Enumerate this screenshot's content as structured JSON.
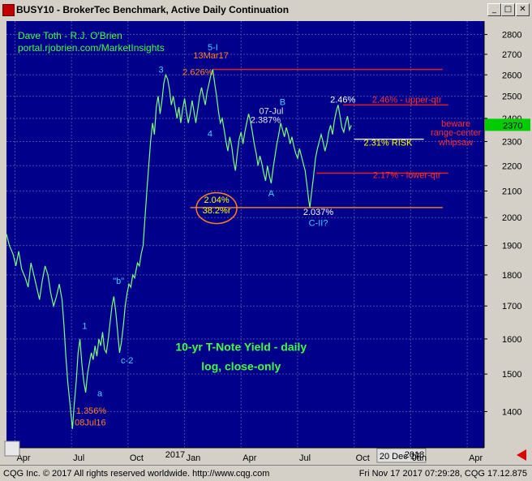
{
  "window": {
    "title": "BUSY10 - BrokerTec Benchmark, Active Daily Continuation",
    "min_label": "_",
    "max_label": "□",
    "close_label": "✕"
  },
  "status": {
    "left": "CQG Inc. © 2017 All rights reserved worldwide. http://www.cqg.com",
    "right": "Fri Nov 17 2017 07:29:28, CQG 17.12.875"
  },
  "chart_data": {
    "type": "line",
    "title": "10-yr T-Note Yield -  daily",
    "subtitle": "log, close-only",
    "credit_line1": "Dave Toth - R.J. O'Brien",
    "credit_line2": "portal.rjobrien.com/MarketInsights",
    "scale": "log",
    "ylim": [
      1310,
      2870
    ],
    "y_ticks": [
      1400,
      1500,
      1600,
      1700,
      1800,
      1900,
      2000,
      2100,
      2200,
      2300,
      2400,
      2500,
      2600,
      2700,
      2800
    ],
    "x_ticks": [
      {
        "label": "Apr",
        "pos": 0
      },
      {
        "label": "Jul",
        "pos": 3
      },
      {
        "label": "Oct",
        "pos": 6
      },
      {
        "label": "2017",
        "pos": 8.5
      },
      {
        "label": "Jan",
        "pos": 9
      },
      {
        "label": "Apr",
        "pos": 12
      },
      {
        "label": "Jul",
        "pos": 15
      },
      {
        "label": "Oct",
        "pos": 18
      },
      {
        "label": "20 Dec 17",
        "pos": 19.3
      },
      {
        "label": "2018",
        "pos": 21.2
      },
      {
        "label": "Jan",
        "pos": 21
      },
      {
        "label": "Apr",
        "pos": 24
      }
    ],
    "last_value_label": "2370",
    "series": [
      {
        "values": [
          [
            -0.45,
            1940
          ],
          [
            -0.3,
            1900
          ],
          [
            -0.1,
            1870
          ],
          [
            0.05,
            1830
          ],
          [
            0.2,
            1880
          ],
          [
            0.35,
            1820
          ],
          [
            0.55,
            1790
          ],
          [
            0.7,
            1760
          ],
          [
            0.85,
            1840
          ],
          [
            1.0,
            1800
          ],
          [
            1.15,
            1760
          ],
          [
            1.3,
            1720
          ],
          [
            1.45,
            1780
          ],
          [
            1.6,
            1830
          ],
          [
            1.75,
            1800
          ],
          [
            1.9,
            1740
          ],
          [
            2.05,
            1700
          ],
          [
            2.2,
            1730
          ],
          [
            2.35,
            1770
          ],
          [
            2.5,
            1720
          ],
          [
            2.6,
            1640
          ],
          [
            2.7,
            1550
          ],
          [
            2.8,
            1480
          ],
          [
            2.9,
            1430
          ],
          [
            3.0,
            1380
          ],
          [
            3.05,
            1356
          ],
          [
            3.15,
            1420
          ],
          [
            3.25,
            1480
          ],
          [
            3.35,
            1560
          ],
          [
            3.45,
            1600
          ],
          [
            3.55,
            1530
          ],
          [
            3.65,
            1480
          ],
          [
            3.75,
            1450
          ],
          [
            3.85,
            1500
          ],
          [
            3.95,
            1530
          ],
          [
            4.05,
            1560
          ],
          [
            4.15,
            1540
          ],
          [
            4.25,
            1580
          ],
          [
            4.35,
            1550
          ],
          [
            4.45,
            1600
          ],
          [
            4.55,
            1580
          ],
          [
            4.65,
            1620
          ],
          [
            4.75,
            1570
          ],
          [
            4.85,
            1560
          ],
          [
            4.95,
            1600
          ],
          [
            5.05,
            1650
          ],
          [
            5.15,
            1700
          ],
          [
            5.25,
            1730
          ],
          [
            5.35,
            1680
          ],
          [
            5.45,
            1620
          ],
          [
            5.55,
            1560
          ],
          [
            5.65,
            1590
          ],
          [
            5.75,
            1640
          ],
          [
            5.85,
            1700
          ],
          [
            5.95,
            1740
          ],
          [
            6.05,
            1770
          ],
          [
            6.15,
            1760
          ],
          [
            6.25,
            1800
          ],
          [
            6.35,
            1790
          ],
          [
            6.5,
            1840
          ],
          [
            6.6,
            1830
          ],
          [
            6.7,
            1870
          ],
          [
            6.8,
            1900
          ],
          [
            6.9,
            2000
          ],
          [
            7.0,
            2100
          ],
          [
            7.1,
            2200
          ],
          [
            7.2,
            2300
          ],
          [
            7.3,
            2380
          ],
          [
            7.4,
            2330
          ],
          [
            7.5,
            2450
          ],
          [
            7.6,
            2500
          ],
          [
            7.7,
            2420
          ],
          [
            7.8,
            2480
          ],
          [
            7.9,
            2560
          ],
          [
            8.0,
            2600
          ],
          [
            8.1,
            2580
          ],
          [
            8.2,
            2530
          ],
          [
            8.3,
            2460
          ],
          [
            8.4,
            2500
          ],
          [
            8.5,
            2450
          ],
          [
            8.6,
            2400
          ],
          [
            8.7,
            2450
          ],
          [
            8.8,
            2380
          ],
          [
            8.9,
            2440
          ],
          [
            9.0,
            2490
          ],
          [
            9.1,
            2430
          ],
          [
            9.2,
            2380
          ],
          [
            9.3,
            2420
          ],
          [
            9.4,
            2480
          ],
          [
            9.5,
            2430
          ],
          [
            9.6,
            2380
          ],
          [
            9.7,
            2440
          ],
          [
            9.8,
            2500
          ],
          [
            9.9,
            2540
          ],
          [
            10.0,
            2500
          ],
          [
            10.1,
            2460
          ],
          [
            10.2,
            2520
          ],
          [
            10.3,
            2560
          ],
          [
            10.4,
            2600
          ],
          [
            10.5,
            2626
          ],
          [
            10.6,
            2560
          ],
          [
            10.7,
            2500
          ],
          [
            10.8,
            2430
          ],
          [
            10.9,
            2380
          ],
          [
            11.0,
            2400
          ],
          [
            11.1,
            2350
          ],
          [
            11.2,
            2300
          ],
          [
            11.3,
            2260
          ],
          [
            11.4,
            2320
          ],
          [
            11.5,
            2280
          ],
          [
            11.6,
            2220
          ],
          [
            11.7,
            2180
          ],
          [
            11.8,
            2250
          ],
          [
            11.9,
            2310
          ],
          [
            12.0,
            2340
          ],
          [
            12.1,
            2290
          ],
          [
            12.2,
            2340
          ],
          [
            12.3,
            2380
          ],
          [
            12.4,
            2420
          ],
          [
            12.5,
            2387
          ],
          [
            12.6,
            2340
          ],
          [
            12.7,
            2290
          ],
          [
            12.8,
            2250
          ],
          [
            12.9,
            2200
          ],
          [
            13.0,
            2240
          ],
          [
            13.1,
            2210
          ],
          [
            13.2,
            2170
          ],
          [
            13.3,
            2140
          ],
          [
            13.4,
            2200
          ],
          [
            13.5,
            2160
          ],
          [
            13.6,
            2130
          ],
          [
            13.7,
            2190
          ],
          [
            13.8,
            2240
          ],
          [
            13.9,
            2290
          ],
          [
            14.0,
            2330
          ],
          [
            14.1,
            2380
          ],
          [
            14.2,
            2350
          ],
          [
            14.3,
            2320
          ],
          [
            14.4,
            2360
          ],
          [
            14.5,
            2330
          ],
          [
            14.6,
            2290
          ],
          [
            14.7,
            2320
          ],
          [
            14.8,
            2280
          ],
          [
            14.9,
            2250
          ],
          [
            15.0,
            2230
          ],
          [
            15.1,
            2270
          ],
          [
            15.2,
            2240
          ],
          [
            15.3,
            2210
          ],
          [
            15.4,
            2180
          ],
          [
            15.5,
            2120
          ],
          [
            15.6,
            2060
          ],
          [
            15.65,
            2037
          ],
          [
            15.75,
            2100
          ],
          [
            15.85,
            2160
          ],
          [
            15.95,
            2230
          ],
          [
            16.05,
            2270
          ],
          [
            16.15,
            2300
          ],
          [
            16.25,
            2330
          ],
          [
            16.35,
            2300
          ],
          [
            16.45,
            2260
          ],
          [
            16.55,
            2290
          ],
          [
            16.65,
            2340
          ],
          [
            16.75,
            2370
          ],
          [
            16.85,
            2330
          ],
          [
            16.95,
            2390
          ],
          [
            17.05,
            2430
          ],
          [
            17.15,
            2460
          ],
          [
            17.25,
            2410
          ],
          [
            17.35,
            2360
          ],
          [
            17.45,
            2340
          ],
          [
            17.55,
            2380
          ],
          [
            17.65,
            2410
          ],
          [
            17.75,
            2350
          ],
          [
            17.85,
            2370
          ]
        ]
      }
    ],
    "annotations": [
      {
        "text": "5-I",
        "x": 10.5,
        "y": 2720,
        "color": "#40d0ff"
      },
      {
        "text": "13Mar17",
        "x": 10.4,
        "y": 2680,
        "color": "#ff8020"
      },
      {
        "text": "2.626%",
        "x": 9.7,
        "y": 2600,
        "color": "#ff8020"
      },
      {
        "text": "3",
        "x": 7.75,
        "y": 2610,
        "color": "#40d0ff"
      },
      {
        "text": "4",
        "x": 10.35,
        "y": 2320,
        "color": "#40d0ff"
      },
      {
        "text": "B",
        "x": 14.2,
        "y": 2460,
        "color": "#40d0ff"
      },
      {
        "text": "07-Jul",
        "x": 13.6,
        "y": 2420,
        "color": "#e0e0e0"
      },
      {
        "text": "2.387%",
        "x": 13.3,
        "y": 2380,
        "color": "#e0e0e0"
      },
      {
        "text": "2.46%",
        "x": 17.4,
        "y": 2470,
        "color": "#ffffff"
      },
      {
        "text": "2.46% - upper-qtr",
        "x": 20.8,
        "y": 2470,
        "color": "#ff3030"
      },
      {
        "text": "2.31% RISK",
        "x": 19.8,
        "y": 2283,
        "color": "#ffff00"
      },
      {
        "text": "beware",
        "x": 23.4,
        "y": 2365,
        "color": "#ff3030"
      },
      {
        "text": "range-center",
        "x": 23.4,
        "y": 2325,
        "color": "#ff3030"
      },
      {
        "text": "whipsaw",
        "x": 23.4,
        "y": 2285,
        "color": "#ff3030"
      },
      {
        "text": "2.17% - lower-qtr",
        "x": 20.8,
        "y": 2150,
        "color": "#ff3030"
      },
      {
        "text": "A",
        "x": 13.6,
        "y": 2080,
        "color": "#40d0ff"
      },
      {
        "text": "2.04%",
        "x": 10.7,
        "y": 2055,
        "color": "#ffff00"
      },
      {
        "text": "38.2%r",
        "x": 10.7,
        "y": 2015,
        "color": "#ffff00"
      },
      {
        "text": "2.037%",
        "x": 16.1,
        "y": 2010,
        "color": "#ffffff"
      },
      {
        "text": "C-II?",
        "x": 16.1,
        "y": 1970,
        "color": "#40d0ff"
      },
      {
        "text": "\"b\"",
        "x": 5.5,
        "y": 1770,
        "color": "#40d0ff"
      },
      {
        "text": "1",
        "x": 3.7,
        "y": 1630,
        "color": "#40d0ff"
      },
      {
        "text": "c-2",
        "x": 5.95,
        "y": 1530,
        "color": "#40d0ff"
      },
      {
        "text": "a",
        "x": 4.5,
        "y": 1440,
        "color": "#40d0ff"
      },
      {
        "text": "1.356%",
        "x": 4.05,
        "y": 1395,
        "color": "#ff8020"
      },
      {
        "text": "08Jul16",
        "x": 4.0,
        "y": 1365,
        "color": "#ff8020"
      }
    ],
    "levels": [
      {
        "value": 2626,
        "from": 10.5,
        "to": 22.7,
        "color": "#e02020"
      },
      {
        "value": 2460,
        "from": 17.4,
        "to": 23.0,
        "color": "#e02020"
      },
      {
        "value": 2310,
        "from": 18.0,
        "to": 21.7,
        "color": "#e0e0e0"
      },
      {
        "value": 2170,
        "from": 16.0,
        "to": 23.0,
        "color": "#e02020"
      },
      {
        "value": 2037,
        "from": 9.3,
        "to": 22.7,
        "color": "#e08020"
      }
    ],
    "grid": true,
    "colors": {
      "background": "#00008b",
      "line": "#7cff7c",
      "grid": "#4a4aa8",
      "axis_bg": "#d4d0c8",
      "last_value_bg": "#00cc00",
      "title": "#40ff40"
    }
  }
}
